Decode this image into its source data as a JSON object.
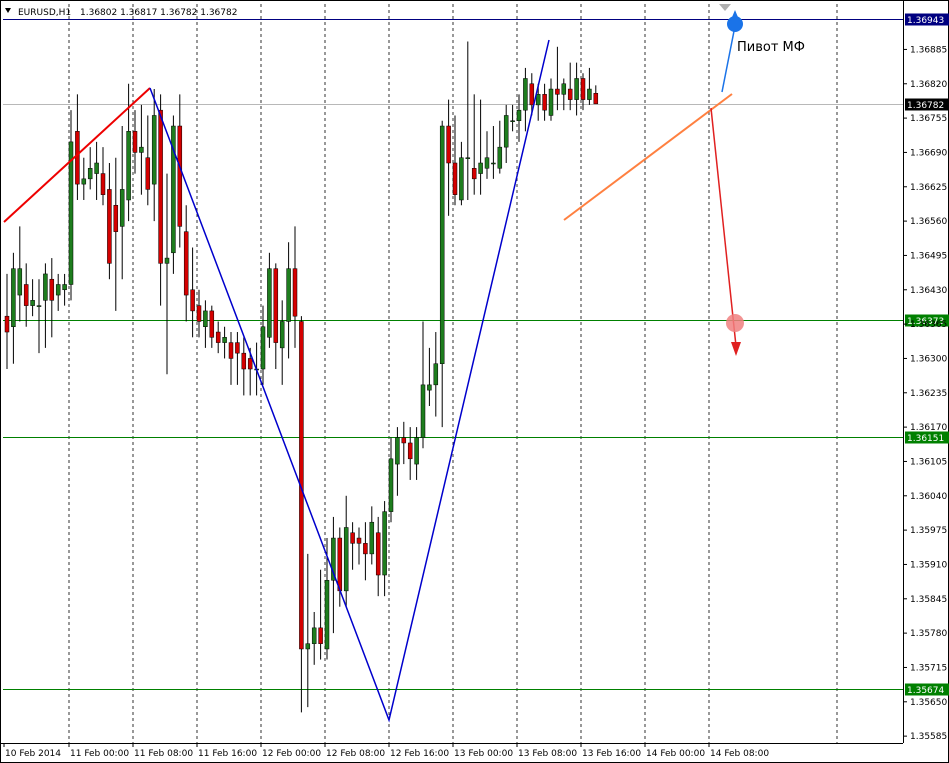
{
  "header": {
    "symbol": "EURUSD,H1",
    "ohlc": "1.36802 1.36817 1.36782 1.36782",
    "icon": "chart-menu-triangle-icon"
  },
  "colors": {
    "bull": "#1e7d1e",
    "bear": "#d40000",
    "wave_red": "#ee0000",
    "wave_blue": "#0000cc",
    "level_green": "#008000",
    "pivot_line": "#000080",
    "current_price_line": "#b8b8b8",
    "trend_orange": "#ff8040",
    "pivot_marker": "#1a73e8",
    "target_marker": "#f08080"
  },
  "annotation": {
    "pivot_label": "Пивот МФ"
  },
  "chart_data": {
    "type": "candlestick",
    "title": "EURUSD,H1",
    "timeframe": "H1",
    "ylim": [
      1.35572,
      1.36971
    ],
    "price_ticks": [
      "1.36885",
      "1.36820",
      "1.36755",
      "1.36690",
      "1.36625",
      "1.36560",
      "1.36495",
      "1.36430",
      "1.36365",
      "1.36300",
      "1.36235",
      "1.36170",
      "1.36105",
      "1.36040",
      "1.35975",
      "1.35910",
      "1.35845",
      "1.35780",
      "1.35715",
      "1.35650",
      "1.35585"
    ],
    "time_labels": [
      "10 Feb 2014",
      "11 Feb 00:00",
      "11 Feb 08:00",
      "11 Feb 16:00",
      "12 Feb 00:00",
      "12 Feb 08:00",
      "12 Feb 16:00",
      "13 Feb 00:00",
      "13 Feb 08:00",
      "13 Feb 16:00",
      "14 Feb 00:00",
      "14 Feb 08:00"
    ],
    "levels": [
      {
        "name": "pivot",
        "value": 1.36943,
        "label": "1.36943",
        "color": "#000080"
      },
      {
        "name": "current",
        "value": 1.36782,
        "label": "1.36782",
        "color": "#000000"
      },
      {
        "name": "support-1",
        "value": 1.36373,
        "label": "1.36373",
        "color": "#008000"
      },
      {
        "name": "support-2",
        "value": 1.36151,
        "label": "1.36151",
        "color": "#008000"
      },
      {
        "name": "support-3",
        "value": 1.35674,
        "label": "1.35674",
        "color": "#008000"
      }
    ],
    "candles": [
      {
        "o": 1.3638,
        "h": 1.3646,
        "l": 1.3628,
        "c": 1.3635
      },
      {
        "o": 1.3636,
        "h": 1.365,
        "l": 1.3629,
        "c": 1.3647
      },
      {
        "o": 1.3642,
        "h": 1.3655,
        "l": 1.3637,
        "c": 1.3647
      },
      {
        "o": 1.3644,
        "h": 1.3648,
        "l": 1.3636,
        "c": 1.364
      },
      {
        "o": 1.364,
        "h": 1.3645,
        "l": 1.3638,
        "c": 1.3641
      },
      {
        "o": 1.364,
        "h": 1.3645,
        "l": 1.3631,
        "c": 1.364
      },
      {
        "o": 1.3641,
        "h": 1.3648,
        "l": 1.3632,
        "c": 1.3646
      },
      {
        "o": 1.3645,
        "h": 1.3649,
        "l": 1.3634,
        "c": 1.3641
      },
      {
        "o": 1.3642,
        "h": 1.3646,
        "l": 1.3639,
        "c": 1.3644
      },
      {
        "o": 1.3643,
        "h": 1.3646,
        "l": 1.364,
        "c": 1.3644
      },
      {
        "o": 1.3644,
        "h": 1.3677,
        "l": 1.3641,
        "c": 1.3671
      },
      {
        "o": 1.3673,
        "h": 1.368,
        "l": 1.366,
        "c": 1.3663
      },
      {
        "o": 1.3663,
        "h": 1.3668,
        "l": 1.366,
        "c": 1.3664
      },
      {
        "o": 1.3664,
        "h": 1.367,
        "l": 1.3662,
        "c": 1.3666
      },
      {
        "o": 1.3665,
        "h": 1.3671,
        "l": 1.366,
        "c": 1.3667
      },
      {
        "o": 1.3665,
        "h": 1.367,
        "l": 1.3659,
        "c": 1.3661
      },
      {
        "o": 1.3662,
        "h": 1.3667,
        "l": 1.3645,
        "c": 1.3648
      },
      {
        "o": 1.3659,
        "h": 1.3668,
        "l": 1.3639,
        "c": 1.3654
      },
      {
        "o": 1.3655,
        "h": 1.3674,
        "l": 1.3645,
        "c": 1.3662
      },
      {
        "o": 1.366,
        "h": 1.3682,
        "l": 1.3656,
        "c": 1.3673
      },
      {
        "o": 1.3673,
        "h": 1.3677,
        "l": 1.3665,
        "c": 1.3669
      },
      {
        "o": 1.3669,
        "h": 1.3678,
        "l": 1.3661,
        "c": 1.367
      },
      {
        "o": 1.3668,
        "h": 1.3676,
        "l": 1.3659,
        "c": 1.3662
      },
      {
        "o": 1.3663,
        "h": 1.3681,
        "l": 1.3656,
        "c": 1.3676
      },
      {
        "o": 1.3677,
        "h": 1.368,
        "l": 1.364,
        "c": 1.3648
      },
      {
        "o": 1.3648,
        "h": 1.3665,
        "l": 1.3627,
        "c": 1.3649
      },
      {
        "o": 1.365,
        "h": 1.3676,
        "l": 1.3646,
        "c": 1.3674
      },
      {
        "o": 1.3674,
        "h": 1.368,
        "l": 1.3651,
        "c": 1.3655
      },
      {
        "o": 1.3654,
        "h": 1.3659,
        "l": 1.3637,
        "c": 1.3642
      },
      {
        "o": 1.3643,
        "h": 1.3651,
        "l": 1.3634,
        "c": 1.3639
      },
      {
        "o": 1.364,
        "h": 1.3643,
        "l": 1.3634,
        "c": 1.3637
      },
      {
        "o": 1.3636,
        "h": 1.3641,
        "l": 1.3632,
        "c": 1.3639
      },
      {
        "o": 1.3639,
        "h": 1.364,
        "l": 1.3632,
        "c": 1.3634
      },
      {
        "o": 1.3635,
        "h": 1.3637,
        "l": 1.3631,
        "c": 1.3633
      },
      {
        "o": 1.3633,
        "h": 1.3636,
        "l": 1.363,
        "c": 1.3634
      },
      {
        "o": 1.3633,
        "h": 1.3635,
        "l": 1.3625,
        "c": 1.363
      },
      {
        "o": 1.3633,
        "h": 1.3635,
        "l": 1.3625,
        "c": 1.3631
      },
      {
        "o": 1.3631,
        "h": 1.3634,
        "l": 1.3623,
        "c": 1.3628
      },
      {
        "o": 1.363,
        "h": 1.3632,
        "l": 1.3623,
        "c": 1.3628
      },
      {
        "o": 1.3628,
        "h": 1.3633,
        "l": 1.3623,
        "c": 1.3628
      },
      {
        "o": 1.3628,
        "h": 1.364,
        "l": 1.3625,
        "c": 1.3636
      },
      {
        "o": 1.3634,
        "h": 1.365,
        "l": 1.3632,
        "c": 1.3647
      },
      {
        "o": 1.3647,
        "h": 1.3648,
        "l": 1.3628,
        "c": 1.3633
      },
      {
        "o": 1.3632,
        "h": 1.3641,
        "l": 1.3625,
        "c": 1.3637
      },
      {
        "o": 1.3637,
        "h": 1.3652,
        "l": 1.363,
        "c": 1.3647
      },
      {
        "o": 1.3647,
        "h": 1.3655,
        "l": 1.3632,
        "c": 1.3638
      },
      {
        "o": 1.3637,
        "h": 1.3638,
        "l": 1.3563,
        "c": 1.3575
      },
      {
        "o": 1.3575,
        "h": 1.3593,
        "l": 1.3564,
        "c": 1.3576
      },
      {
        "o": 1.3576,
        "h": 1.3582,
        "l": 1.3572,
        "c": 1.3579
      },
      {
        "o": 1.3579,
        "h": 1.359,
        "l": 1.3573,
        "c": 1.3576
      },
      {
        "o": 1.3575,
        "h": 1.3596,
        "l": 1.3573,
        "c": 1.3588
      },
      {
        "o": 1.3588,
        "h": 1.36,
        "l": 1.3578,
        "c": 1.3596
      },
      {
        "o": 1.3596,
        "h": 1.3598,
        "l": 1.3583,
        "c": 1.3586
      },
      {
        "o": 1.3586,
        "h": 1.3604,
        "l": 1.3583,
        "c": 1.3598
      },
      {
        "o": 1.3597,
        "h": 1.3599,
        "l": 1.359,
        "c": 1.3595
      },
      {
        "o": 1.3596,
        "h": 1.3598,
        "l": 1.3591,
        "c": 1.3595
      },
      {
        "o": 1.3595,
        "h": 1.3599,
        "l": 1.3588,
        "c": 1.3593
      },
      {
        "o": 1.3593,
        "h": 1.3602,
        "l": 1.3591,
        "c": 1.3599
      },
      {
        "o": 1.3597,
        "h": 1.36,
        "l": 1.3585,
        "c": 1.3589
      },
      {
        "o": 1.3589,
        "h": 1.3603,
        "l": 1.3585,
        "c": 1.3601
      },
      {
        "o": 1.3601,
        "h": 1.3615,
        "l": 1.3599,
        "c": 1.3611
      },
      {
        "o": 1.361,
        "h": 1.3617,
        "l": 1.3604,
        "c": 1.3615
      },
      {
        "o": 1.3615,
        "h": 1.3618,
        "l": 1.361,
        "c": 1.3614
      },
      {
        "o": 1.3614,
        "h": 1.3617,
        "l": 1.3607,
        "c": 1.3611
      },
      {
        "o": 1.361,
        "h": 1.3617,
        "l": 1.3607,
        "c": 1.3615
      },
      {
        "o": 1.3615,
        "h": 1.3637,
        "l": 1.3613,
        "c": 1.3625
      },
      {
        "o": 1.3624,
        "h": 1.3632,
        "l": 1.3621,
        "c": 1.3625
      },
      {
        "o": 1.3625,
        "h": 1.3635,
        "l": 1.3619,
        "c": 1.3629
      },
      {
        "o": 1.3629,
        "h": 1.3675,
        "l": 1.3617,
        "c": 1.3674
      },
      {
        "o": 1.3674,
        "h": 1.3679,
        "l": 1.3657,
        "c": 1.3667
      },
      {
        "o": 1.3667,
        "h": 1.3676,
        "l": 1.3659,
        "c": 1.3661
      },
      {
        "o": 1.366,
        "h": 1.3671,
        "l": 1.3659,
        "c": 1.3668
      },
      {
        "o": 1.3668,
        "h": 1.369,
        "l": 1.366,
        "c": 1.3668
      },
      {
        "o": 1.3666,
        "h": 1.368,
        "l": 1.3661,
        "c": 1.3664
      },
      {
        "o": 1.3665,
        "h": 1.3679,
        "l": 1.3661,
        "c": 1.3667
      },
      {
        "o": 1.3666,
        "h": 1.3673,
        "l": 1.3664,
        "c": 1.3668
      },
      {
        "o": 1.3667,
        "h": 1.3674,
        "l": 1.3664,
        "c": 1.3667
      },
      {
        "o": 1.3666,
        "h": 1.3675,
        "l": 1.3665,
        "c": 1.367
      },
      {
        "o": 1.367,
        "h": 1.3678,
        "l": 1.3667,
        "c": 1.3676
      },
      {
        "o": 1.3675,
        "h": 1.3678,
        "l": 1.3673,
        "c": 1.3675
      },
      {
        "o": 1.3675,
        "h": 1.368,
        "l": 1.3671,
        "c": 1.3677
      },
      {
        "o": 1.3677,
        "h": 1.3685,
        "l": 1.3673,
        "c": 1.3683
      },
      {
        "o": 1.3682,
        "h": 1.3684,
        "l": 1.3676,
        "c": 1.3678
      },
      {
        "o": 1.3678,
        "h": 1.3682,
        "l": 1.3675,
        "c": 1.368
      },
      {
        "o": 1.368,
        "h": 1.3682,
        "l": 1.3675,
        "c": 1.3677
      },
      {
        "o": 1.3676,
        "h": 1.3683,
        "l": 1.3675,
        "c": 1.3681
      },
      {
        "o": 1.3681,
        "h": 1.3689,
        "l": 1.3677,
        "c": 1.368
      },
      {
        "o": 1.368,
        "h": 1.3683,
        "l": 1.3677,
        "c": 1.3682
      },
      {
        "o": 1.3681,
        "h": 1.3686,
        "l": 1.3677,
        "c": 1.3679
      },
      {
        "o": 1.3679,
        "h": 1.3686,
        "l": 1.3676,
        "c": 1.3683
      },
      {
        "o": 1.3683,
        "h": 1.3684,
        "l": 1.3677,
        "c": 1.3679
      },
      {
        "o": 1.3679,
        "h": 1.3685,
        "l": 1.3678,
        "c": 1.3681
      },
      {
        "o": 1.36802,
        "h": 1.36817,
        "l": 1.36782,
        "c": 1.36782
      }
    ]
  }
}
